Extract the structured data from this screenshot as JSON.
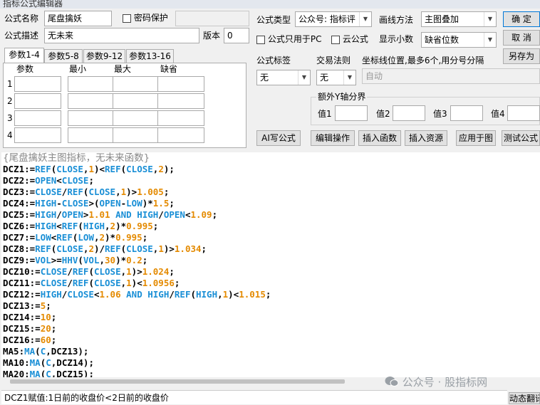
{
  "window": {
    "title": "指标公式编辑器"
  },
  "header": {
    "name_label": "公式名称",
    "name_value": "尾盘擒妖",
    "password_label": "密码保护",
    "desc_label": "公式描述",
    "desc_value": "无未来",
    "version_label": "版本",
    "version_value": "0",
    "type_label": "公式类型",
    "type_value": "公众号: 指标评",
    "draw_label": "画线方法",
    "draw_value": "主图叠加",
    "pc_only_label": "公式只用于PC",
    "cloud_label": "云公式",
    "decimals_label": "显示小数",
    "decimals_value": "缺省位数"
  },
  "buttons": {
    "ok": "确  定",
    "cancel": "取  消",
    "save_as": "另存为"
  },
  "tabs": [
    {
      "label": "参数1-4"
    },
    {
      "label": "参数5-8"
    },
    {
      "label": "参数9-12"
    },
    {
      "label": "参数13-16"
    }
  ],
  "params": {
    "headers": [
      "参数",
      "最小",
      "最大",
      "缺省"
    ],
    "rows": [
      "1",
      "2",
      "3",
      "4"
    ]
  },
  "options": {
    "tag_label": "公式标签",
    "tag_value": "无",
    "rule_label": "交易法则",
    "rule_value": "无",
    "coord_label": "坐标线位置,最多6个,用分号分隔",
    "coord_value": "自动",
    "y_group_label": "额外Y轴分界",
    "y_labels": [
      "值1",
      "值2",
      "值3",
      "值4"
    ]
  },
  "actions": [
    "AI写公式",
    "编辑操作",
    "插入函数",
    "插入资源",
    "应用于图",
    "测试公式"
  ],
  "code": [
    [
      [
        "cm",
        "{尾盘擒妖主图指标，无未来函数}"
      ]
    ],
    [
      [
        "v",
        "DCZ1:="
      ],
      [
        "fn",
        "REF"
      ],
      [
        "v",
        "("
      ],
      [
        "fn",
        "CLOSE"
      ],
      [
        "v",
        ","
      ],
      [
        "num",
        "1"
      ],
      [
        "v",
        ")<"
      ],
      [
        "fn",
        "REF"
      ],
      [
        "v",
        "("
      ],
      [
        "fn",
        "CLOSE"
      ],
      [
        "v",
        ","
      ],
      [
        "num",
        "2"
      ],
      [
        "v",
        ");"
      ]
    ],
    [
      [
        "v",
        "DCZ2:="
      ],
      [
        "fn",
        "OPEN"
      ],
      [
        "v",
        "<"
      ],
      [
        "fn",
        "CLOSE"
      ],
      [
        "v",
        ";"
      ]
    ],
    [
      [
        "v",
        "DCZ3:="
      ],
      [
        "fn",
        "CLOSE"
      ],
      [
        "v",
        "/"
      ],
      [
        "fn",
        "REF"
      ],
      [
        "v",
        "("
      ],
      [
        "fn",
        "CLOSE"
      ],
      [
        "v",
        ","
      ],
      [
        "num",
        "1"
      ],
      [
        "v",
        ")>"
      ],
      [
        "num",
        "1.005"
      ],
      [
        "v",
        ";"
      ]
    ],
    [
      [
        "v",
        "DCZ4:="
      ],
      [
        "fn",
        "HIGH"
      ],
      [
        "v",
        "-"
      ],
      [
        "fn",
        "CLOSE"
      ],
      [
        "v",
        ">("
      ],
      [
        "fn",
        "OPEN"
      ],
      [
        "v",
        "-"
      ],
      [
        "fn",
        "LOW"
      ],
      [
        "v",
        ")*"
      ],
      [
        "num",
        "1.5"
      ],
      [
        "v",
        ";"
      ]
    ],
    [
      [
        "v",
        "DCZ5:="
      ],
      [
        "fn",
        "HIGH"
      ],
      [
        "v",
        "/"
      ],
      [
        "fn",
        "OPEN"
      ],
      [
        "v",
        ">"
      ],
      [
        "num",
        "1.01"
      ],
      [
        "v",
        " "
      ],
      [
        "kw",
        "AND"
      ],
      [
        "v",
        " "
      ],
      [
        "fn",
        "HIGH"
      ],
      [
        "v",
        "/"
      ],
      [
        "fn",
        "OPEN"
      ],
      [
        "v",
        "<"
      ],
      [
        "num",
        "1.09"
      ],
      [
        "v",
        ";"
      ]
    ],
    [
      [
        "v",
        "DCZ6:="
      ],
      [
        "fn",
        "HIGH"
      ],
      [
        "v",
        "<"
      ],
      [
        "fn",
        "REF"
      ],
      [
        "v",
        "("
      ],
      [
        "fn",
        "HIGH"
      ],
      [
        "v",
        ","
      ],
      [
        "num",
        "2"
      ],
      [
        "v",
        ")*"
      ],
      [
        "num",
        "0.995"
      ],
      [
        "v",
        ";"
      ]
    ],
    [
      [
        "v",
        "DCZ7:="
      ],
      [
        "fn",
        "LOW"
      ],
      [
        "v",
        "<"
      ],
      [
        "fn",
        "REF"
      ],
      [
        "v",
        "("
      ],
      [
        "fn",
        "LOW"
      ],
      [
        "v",
        ","
      ],
      [
        "num",
        "2"
      ],
      [
        "v",
        ")*"
      ],
      [
        "num",
        "0.995"
      ],
      [
        "v",
        ";"
      ]
    ],
    [
      [
        "v",
        "DCZ8:="
      ],
      [
        "fn",
        "REF"
      ],
      [
        "v",
        "("
      ],
      [
        "fn",
        "CLOSE"
      ],
      [
        "v",
        ","
      ],
      [
        "num",
        "2"
      ],
      [
        "v",
        ")/"
      ],
      [
        "fn",
        "REF"
      ],
      [
        "v",
        "("
      ],
      [
        "fn",
        "CLOSE"
      ],
      [
        "v",
        ","
      ],
      [
        "num",
        "1"
      ],
      [
        "v",
        ")>"
      ],
      [
        "num",
        "1.034"
      ],
      [
        "v",
        ";"
      ]
    ],
    [
      [
        "v",
        "DCZ9:="
      ],
      [
        "fn",
        "VOL"
      ],
      [
        "v",
        ">="
      ],
      [
        "fn",
        "HHV"
      ],
      [
        "v",
        "("
      ],
      [
        "fn",
        "VOL"
      ],
      [
        "v",
        ","
      ],
      [
        "num",
        "30"
      ],
      [
        "v",
        ")*"
      ],
      [
        "num",
        "0.2"
      ],
      [
        "v",
        ";"
      ]
    ],
    [
      [
        "v",
        "DCZ10:="
      ],
      [
        "fn",
        "CLOSE"
      ],
      [
        "v",
        "/"
      ],
      [
        "fn",
        "REF"
      ],
      [
        "v",
        "("
      ],
      [
        "fn",
        "CLOSE"
      ],
      [
        "v",
        ","
      ],
      [
        "num",
        "1"
      ],
      [
        "v",
        ")>"
      ],
      [
        "num",
        "1.024"
      ],
      [
        "v",
        ";"
      ]
    ],
    [
      [
        "v",
        "DCZ11:="
      ],
      [
        "fn",
        "CLOSE"
      ],
      [
        "v",
        "/"
      ],
      [
        "fn",
        "REF"
      ],
      [
        "v",
        "("
      ],
      [
        "fn",
        "CLOSE"
      ],
      [
        "v",
        ","
      ],
      [
        "num",
        "1"
      ],
      [
        "v",
        ")<"
      ],
      [
        "num",
        "1.0956"
      ],
      [
        "v",
        ";"
      ]
    ],
    [
      [
        "v",
        "DCZ12:="
      ],
      [
        "fn",
        "HIGH"
      ],
      [
        "v",
        "/"
      ],
      [
        "fn",
        "CLOSE"
      ],
      [
        "v",
        "<"
      ],
      [
        "num",
        "1.06"
      ],
      [
        "v",
        " "
      ],
      [
        "kw",
        "AND"
      ],
      [
        "v",
        " "
      ],
      [
        "fn",
        "HIGH"
      ],
      [
        "v",
        "/"
      ],
      [
        "fn",
        "REF"
      ],
      [
        "v",
        "("
      ],
      [
        "fn",
        "HIGH"
      ],
      [
        "v",
        ","
      ],
      [
        "num",
        "1"
      ],
      [
        "v",
        ")<"
      ],
      [
        "num",
        "1.015"
      ],
      [
        "v",
        ";"
      ]
    ],
    [
      [
        "v",
        "DCZ13:="
      ],
      [
        "num",
        "5"
      ],
      [
        "v",
        ";"
      ]
    ],
    [
      [
        "v",
        "DCZ14:="
      ],
      [
        "num",
        "10"
      ],
      [
        "v",
        ";"
      ]
    ],
    [
      [
        "v",
        "DCZ15:="
      ],
      [
        "num",
        "20"
      ],
      [
        "v",
        ";"
      ]
    ],
    [
      [
        "v",
        "DCZ16:="
      ],
      [
        "num",
        "60"
      ],
      [
        "v",
        ";"
      ]
    ],
    [
      [
        "v",
        "MA5:"
      ],
      [
        "fn",
        "MA"
      ],
      [
        "v",
        "("
      ],
      [
        "fn",
        "C"
      ],
      [
        "v",
        ",DCZ13);"
      ]
    ],
    [
      [
        "v",
        "MA10:"
      ],
      [
        "fn",
        "MA"
      ],
      [
        "v",
        "("
      ],
      [
        "fn",
        "C"
      ],
      [
        "v",
        ",DCZ14);"
      ]
    ],
    [
      [
        "v",
        "MA20:"
      ],
      [
        "fn",
        "MA"
      ],
      [
        "v",
        "("
      ],
      [
        "fn",
        "C"
      ],
      [
        "v",
        ",DCZ15);"
      ]
    ]
  ],
  "status": {
    "text": "DCZ1赋值:1日前的收盘价<2日前的收盘价",
    "dynamic_btn": "动态翻译"
  },
  "watermark": "公众号 · 股指标网"
}
